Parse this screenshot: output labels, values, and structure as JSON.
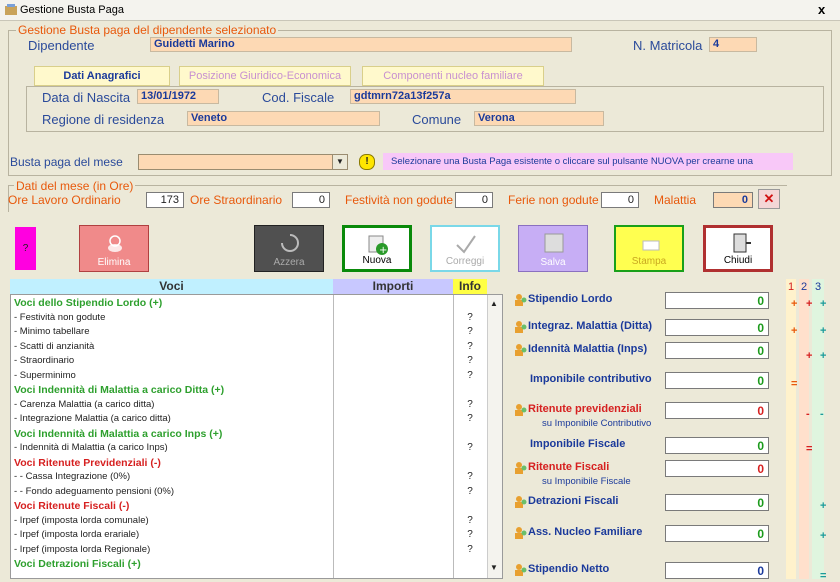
{
  "window": {
    "title": "Gestione Busta Paga",
    "close": "x"
  },
  "employee_group": {
    "legend": "Gestione Busta paga del dipendente selezionato",
    "dipendente_label": "Dipendente",
    "dipendente_value": "Guidetti Marino",
    "matricola_label": "N. Matricola",
    "matricola_value": "4",
    "tabs": [
      "Dati Anagrafici",
      "Posizione Giuridico-Economica",
      "Componenti nucleo familiare"
    ],
    "nascita_label": "Data di Nascita",
    "nascita_value": "13/01/1972",
    "codfisc_label": "Cod. Fiscale",
    "codfisc_value": "gdtmrn72a13f257a",
    "regione_label": "Regione di residenza",
    "regione_value": "Veneto",
    "comune_label": "Comune",
    "comune_value": "Verona"
  },
  "busta": {
    "label": "Busta paga del mese",
    "selected": "",
    "hint_icon": "!",
    "hint": "Selezionare una Busta Paga esistente  o cliccare sul pulsante NUOVA per crearne una"
  },
  "ore": {
    "legend": "Dati del mese (in Ore)",
    "ordinario_label": "Ore Lavoro Ordinario",
    "ordinario_value": "173",
    "straordinario_label": "Ore Straordinario",
    "straordinario_value": "0",
    "festivita_label": "Festività non godute",
    "festivita_value": "0",
    "ferie_label": "Ferie non godute",
    "ferie_value": "0",
    "malattia_label": "Malattia",
    "malattia_value": "0",
    "malattia_clear": "✕"
  },
  "toolbar": {
    "help": "?",
    "elimina": "Elimina",
    "azzera": "Azzera",
    "nuova": "Nuova",
    "correggi": "Correggi",
    "salva": "Salva",
    "stampa": "Stampa",
    "chiudi": "Chiudi"
  },
  "grid": {
    "headers": {
      "voci": "Voci",
      "importi": "Importi",
      "info": "Info"
    },
    "rows": [
      {
        "text": "Voci dello Stipendio Lordo (+)",
        "kind": "sec",
        "color": "#2ea02e",
        "info": ""
      },
      {
        "text": " - Festività non godute",
        "kind": "item",
        "color": "#222222",
        "info": "?"
      },
      {
        "text": " - Minimo tabellare",
        "kind": "item",
        "color": "#222222",
        "info": "?"
      },
      {
        "text": " - Scatti di anzianità",
        "kind": "item",
        "color": "#222222",
        "info": "?"
      },
      {
        "text": " - Straordinario",
        "kind": "item",
        "color": "#222222",
        "info": "?"
      },
      {
        "text": " - Superminimo",
        "kind": "item",
        "color": "#222222",
        "info": "?"
      },
      {
        "text": "Voci Indennità di Malattia a carico Ditta (+)",
        "kind": "sec",
        "color": "#2ea02e",
        "info": ""
      },
      {
        "text": " - Carenza Malattia (a carico ditta)",
        "kind": "item",
        "color": "#222222",
        "info": "?"
      },
      {
        "text": " - Integrazione Malattia (a carico ditta)",
        "kind": "item",
        "color": "#222222",
        "info": "?"
      },
      {
        "text": "Voci Indennità di Malattia a carico Inps (+)",
        "kind": "sec",
        "color": "#2ea02e",
        "info": ""
      },
      {
        "text": " - Indennità di Malattia (a carico Inps)",
        "kind": "item",
        "color": "#222222",
        "info": "?"
      },
      {
        "text": "Voci Ritenute Previdenziali (-)",
        "kind": "sec",
        "color": "#d62020",
        "info": ""
      },
      {
        "text": " -   - Cassa Integrazione (0%)",
        "kind": "item",
        "color": "#222222",
        "info": "?"
      },
      {
        "text": " -   - Fondo adeguamento pensioni (0%)",
        "kind": "item",
        "color": "#222222",
        "info": "?"
      },
      {
        "text": "Voci Ritenute Fiscali (-)",
        "kind": "sec",
        "color": "#d62020",
        "info": ""
      },
      {
        "text": " - Irpef (imposta lorda comunale)",
        "kind": "item",
        "color": "#222222",
        "info": "?"
      },
      {
        "text": " - Irpef (imposta lorda erariale)",
        "kind": "item",
        "color": "#222222",
        "info": "?"
      },
      {
        "text": " - Irpef (imposta lorda Regionale)",
        "kind": "item",
        "color": "#222222",
        "info": "?"
      },
      {
        "text": "Voci Detrazioni Fiscali (+)",
        "kind": "sec",
        "color": "#2ea02e",
        "info": ""
      }
    ]
  },
  "summary": {
    "stipendio_lordo": {
      "label": "Stipendio Lordo",
      "value": "0"
    },
    "integraz_malattia": {
      "label": "Integraz. Malattia  (Ditta)",
      "value": "0"
    },
    "indennita_malattia": {
      "label": "Idennità Malattia  (Inps)",
      "value": "0"
    },
    "imponibile_contributivo": {
      "label": "Imponibile contributivo",
      "value": "0"
    },
    "ritenute_previdenziali": {
      "label": "Ritenute previdenziali",
      "sub": "su Imponibile Contributivo",
      "value": "0"
    },
    "imponibile_fiscale": {
      "label": "Imponibile Fiscale",
      "value": "0"
    },
    "ritenute_fiscali": {
      "label": "Ritenute Fiscali",
      "sub": "su Imponibile Fiscale",
      "value": "0"
    },
    "detrazioni_fiscali": {
      "label": "Detrazioni Fiscali",
      "value": "0"
    },
    "ass_nucleo": {
      "label": "Ass. Nucleo Familiare",
      "value": "0"
    },
    "stipendio_netto": {
      "label": "Stipendio Netto",
      "value": "0"
    }
  },
  "columns": {
    "headers": [
      "1",
      "2",
      "3"
    ],
    "marks": {
      "col1": [
        "+",
        "+",
        "="
      ],
      "col2": [
        "+",
        "+",
        "-",
        "="
      ],
      "col3": [
        "+",
        "+",
        "+",
        "-",
        "+",
        "+",
        "="
      ]
    }
  },
  "colors": {
    "field": "#fdd9b4",
    "legend": "#e8590c",
    "label": "#2a4a9a",
    "tab_bg": "#fff9cc",
    "hint_bg": "#f8c8f8",
    "info_header": "#ffff44",
    "importi_header": "#c8c8ff",
    "voci_header": "#c0f0ff"
  }
}
